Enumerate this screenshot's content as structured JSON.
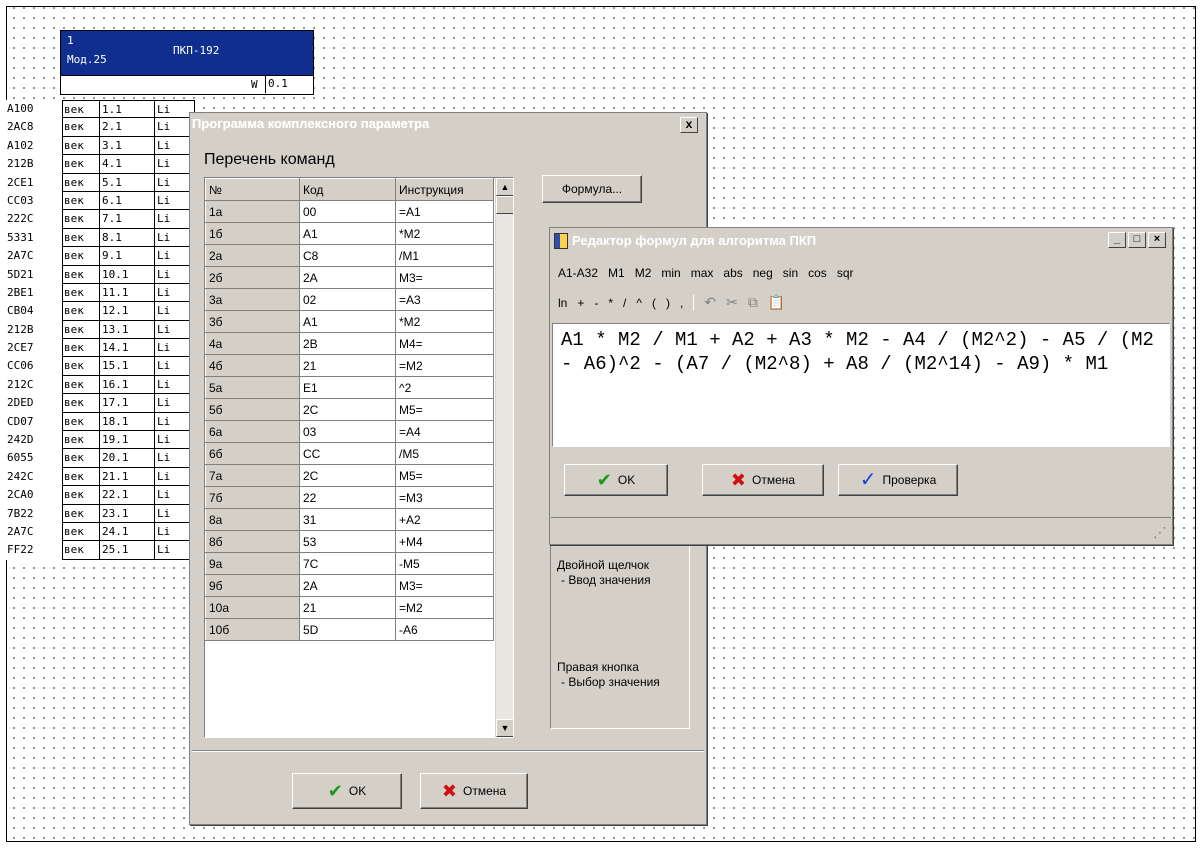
{
  "module": {
    "number": "1",
    "mod": "Мод.25",
    "name": "ПКП-192",
    "w_label": "W",
    "w_value": "0.1",
    "rows": [
      {
        "addr": "A100",
        "type": "век",
        "num": "1.1",
        "li": "Li"
      },
      {
        "addr": "2AC8",
        "type": "век",
        "num": "2.1",
        "li": "Li"
      },
      {
        "addr": "A102",
        "type": "век",
        "num": "3.1",
        "li": "Li"
      },
      {
        "addr": "212B",
        "type": "век",
        "num": "4.1",
        "li": "Li"
      },
      {
        "addr": "2CE1",
        "type": "век",
        "num": "5.1",
        "li": "Li"
      },
      {
        "addr": "CC03",
        "type": "век",
        "num": "6.1",
        "li": "Li"
      },
      {
        "addr": "222C",
        "type": "век",
        "num": "7.1",
        "li": "Li"
      },
      {
        "addr": "5331",
        "type": "век",
        "num": "8.1",
        "li": "Li"
      },
      {
        "addr": "2A7C",
        "type": "век",
        "num": "9.1",
        "li": "Li"
      },
      {
        "addr": "5D21",
        "type": "век",
        "num": "10.1",
        "li": "Li"
      },
      {
        "addr": "2BE1",
        "type": "век",
        "num": "11.1",
        "li": "Li"
      },
      {
        "addr": "CB04",
        "type": "век",
        "num": "12.1",
        "li": "Li"
      },
      {
        "addr": "212B",
        "type": "век",
        "num": "13.1",
        "li": "Li"
      },
      {
        "addr": "2CE7",
        "type": "век",
        "num": "14.1",
        "li": "Li"
      },
      {
        "addr": "CC06",
        "type": "век",
        "num": "15.1",
        "li": "Li"
      },
      {
        "addr": "212C",
        "type": "век",
        "num": "16.1",
        "li": "Li"
      },
      {
        "addr": "2DED",
        "type": "век",
        "num": "17.1",
        "li": "Li"
      },
      {
        "addr": "CD07",
        "type": "век",
        "num": "18.1",
        "li": "Li"
      },
      {
        "addr": "242D",
        "type": "век",
        "num": "19.1",
        "li": "Li"
      },
      {
        "addr": "6055",
        "type": "век",
        "num": "20.1",
        "li": "Li"
      },
      {
        "addr": "242C",
        "type": "век",
        "num": "21.1",
        "li": "Li"
      },
      {
        "addr": "2CA0",
        "type": "век",
        "num": "22.1",
        "li": "Li"
      },
      {
        "addr": "7B22",
        "type": "век",
        "num": "23.1",
        "li": "Li"
      },
      {
        "addr": "2A7C",
        "type": "век",
        "num": "24.1",
        "li": "Li"
      },
      {
        "addr": "FF22",
        "type": "век",
        "num": "25.1",
        "li": "Li"
      }
    ]
  },
  "program_dialog": {
    "title": "Программа комплексного параметра",
    "close": "x",
    "list_label": "Перечень команд",
    "columns": [
      "№",
      "Код",
      "Инструкция"
    ],
    "rows": [
      {
        "no": "1a",
        "code": "00",
        "instr": "=A1"
      },
      {
        "no": "1б",
        "code": "A1",
        "instr": "*M2"
      },
      {
        "no": "2a",
        "code": "C8",
        "instr": "/M1"
      },
      {
        "no": "2б",
        "code": "2A",
        "instr": "M3="
      },
      {
        "no": "3a",
        "code": "02",
        "instr": "=A3"
      },
      {
        "no": "3б",
        "code": "A1",
        "instr": "*M2"
      },
      {
        "no": "4a",
        "code": "2B",
        "instr": "M4="
      },
      {
        "no": "4б",
        "code": "21",
        "instr": "=M2"
      },
      {
        "no": "5a",
        "code": "E1",
        "instr": "^2"
      },
      {
        "no": "5б",
        "code": "2C",
        "instr": "M5="
      },
      {
        "no": "6a",
        "code": "03",
        "instr": "=A4"
      },
      {
        "no": "6б",
        "code": "CC",
        "instr": "/M5"
      },
      {
        "no": "7a",
        "code": "2C",
        "instr": "M5="
      },
      {
        "no": "7б",
        "code": "22",
        "instr": "=M3"
      },
      {
        "no": "8a",
        "code": "31",
        "instr": "+A2"
      },
      {
        "no": "8б",
        "code": "53",
        "instr": "+M4"
      },
      {
        "no": "9a",
        "code": "7C",
        "instr": "-M5"
      },
      {
        "no": "9б",
        "code": "2A",
        "instr": "M3="
      },
      {
        "no": "10a",
        "code": "21",
        "instr": "=M2"
      },
      {
        "no": "10б",
        "code": "5D",
        "instr": "-A6"
      }
    ],
    "formula_button": "Формула...",
    "hint_double_click": "Двойной щелчок",
    "hint_double_click_action": "- Ввод значения",
    "hint_right_button": "Правая кнопка",
    "hint_right_button_action": "- Выбор значения",
    "ok_label": "OK",
    "cancel_label": "Отмена"
  },
  "formula_editor": {
    "title": "Редактор формул для алгоритма ПКП",
    "functions": [
      "A1-A32",
      "M1",
      "M2",
      "min",
      "max",
      "abs",
      "neg",
      "sin",
      "cos",
      "sqr"
    ],
    "operators": [
      "ln",
      "+",
      "-",
      "*",
      "/",
      "^",
      "(",
      ")",
      ","
    ],
    "formula": "A1 * M2 / M1 + A2 + A3 * M2 - A4 / (M2^2) - A5 / (M2 - A6)^2 - (A7 / (M2^8) + A8 / (M2^14) - A9) * M1",
    "ok_label": "OK",
    "cancel_label": "Отмена",
    "check_label": "Проверка"
  }
}
